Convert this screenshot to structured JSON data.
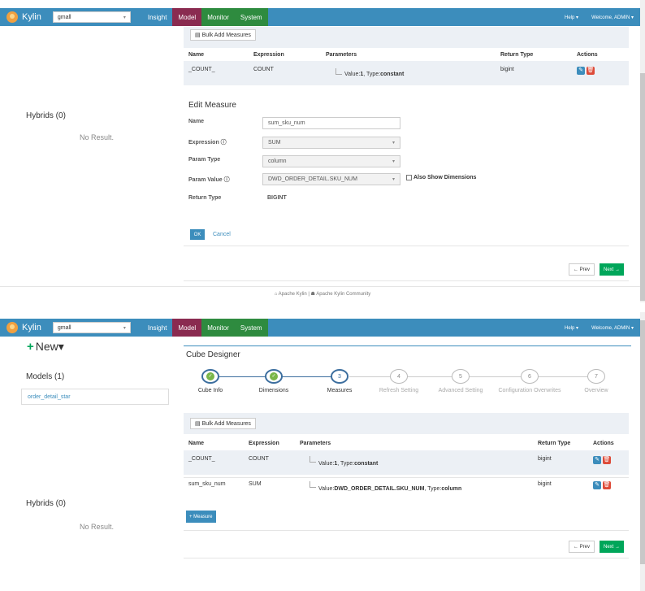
{
  "common": {
    "brand": "Kylin",
    "project": "gmall",
    "nav": {
      "insight": "Insight",
      "model": "Model",
      "monitor": "Monitor",
      "system": "System"
    },
    "help": "Help ▾",
    "welcome": "Welcome, ADMIN ▾",
    "hybrids": "Hybrids (0)",
    "no_result": "No Result.",
    "bulk_add": "Bulk Add Measures",
    "prev": "← Prev",
    "next": "Next →",
    "table_headers": {
      "name": "Name",
      "expression": "Expression",
      "parameters": "Parameters",
      "return_type": "Return Type",
      "actions": "Actions"
    }
  },
  "top": {
    "rows": [
      {
        "name": "_COUNT_",
        "expression": "COUNT",
        "param_prefix": "Value:",
        "param_value": "1",
        "param_sep": ", Type:",
        "param_type": "constant",
        "return_type": "bigint"
      }
    ],
    "edit_measure": {
      "title": "Edit Measure",
      "name_label": "Name",
      "name_value": "sum_sku_num",
      "expression_label": "Expression ⓘ",
      "expression_value": "SUM",
      "param_type_label": "Param Type",
      "param_type_value": "column",
      "param_value_label": "Param Value ⓘ",
      "param_value_value": "DWD_ORDER_DETAIL.SKU_NUM",
      "also_show": "Also Show Dimensions",
      "return_type_label": "Return Type",
      "return_type_value": "BIGINT",
      "ok": "OK",
      "cancel": "Cancel"
    },
    "footer": "⌂ Apache Kylin | ☗ Apache Kylin Community"
  },
  "bottom": {
    "new": "New▾",
    "models": "Models (1)",
    "model_item": "order_detail_star",
    "designer": "Cube Designer",
    "steps": [
      {
        "num": "✓",
        "label": "Cube Info",
        "state": "done"
      },
      {
        "num": "✓",
        "label": "Dimensions",
        "state": "done"
      },
      {
        "num": "3",
        "label": "Measures",
        "state": "active"
      },
      {
        "num": "4",
        "label": "Refresh Setting",
        "state": "todo"
      },
      {
        "num": "5",
        "label": "Advanced Setting",
        "state": "todo"
      },
      {
        "num": "6",
        "label": "Configuration Overwrites",
        "state": "todo"
      },
      {
        "num": "7",
        "label": "Overview",
        "state": "todo"
      }
    ],
    "rows": [
      {
        "name": "_COUNT_",
        "expression": "COUNT",
        "param_prefix": "Value:",
        "param_value": "1",
        "param_sep": ", Type:",
        "param_type": "constant",
        "return_type": "bigint"
      },
      {
        "name": "sum_sku_num",
        "expression": "SUM",
        "param_prefix": "Value:",
        "param_value": "DWD_ORDER_DETAIL.SKU_NUM",
        "param_sep": ", Type:",
        "param_type": "column",
        "return_type": "bigint"
      }
    ],
    "add_measure": "+ Measure"
  },
  "colors": {
    "navbar": "#3c8dbc",
    "model_tab": "#8a2b50",
    "green_tab": "#2e8b3f",
    "next": "#00a65a",
    "delete": "#dd4b39"
  }
}
